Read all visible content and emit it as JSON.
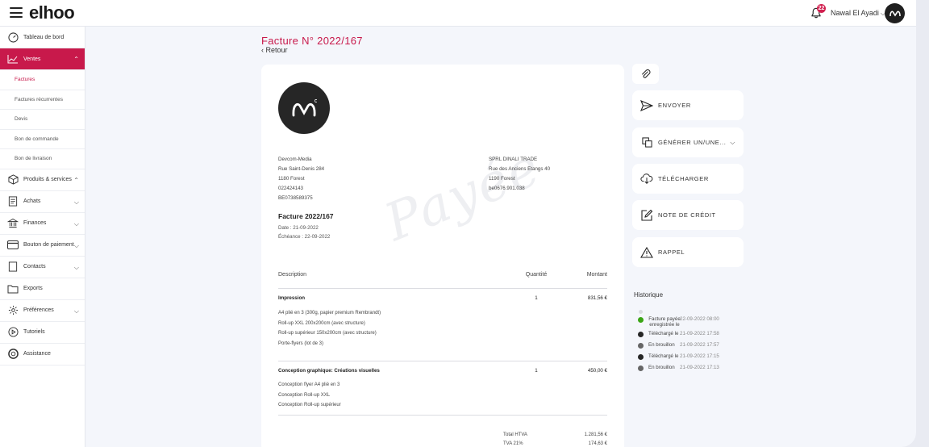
{
  "app": {
    "logo": "elhoo",
    "notifications_count": "22",
    "user_name": "Nawal El Ayadi",
    "avatar_text": "ɯ"
  },
  "sidebar": {
    "items": [
      {
        "label": "Tableau de bord",
        "icon": "gauge-icon"
      },
      {
        "label": "Ventes",
        "icon": "chart-line-icon",
        "active": true
      },
      {
        "label": "Produits & services",
        "icon": "box-icon"
      },
      {
        "label": "Achats",
        "icon": "receipt-icon"
      },
      {
        "label": "Finances",
        "icon": "bank-icon"
      },
      {
        "label": "Bouton de paiement",
        "icon": "card-icon"
      },
      {
        "label": "Contacts",
        "icon": "contact-icon"
      },
      {
        "label": "Exports",
        "icon": "folder-icon"
      },
      {
        "label": "Préférences",
        "icon": "gear-icon"
      },
      {
        "label": "Tutoriels",
        "icon": "play-icon"
      },
      {
        "label": "Assistance",
        "icon": "lifebuoy-icon"
      }
    ],
    "sub_items": [
      "Factures",
      "Factures récurrentes",
      "Devis",
      "Bon de commande",
      "Bon de livraison"
    ]
  },
  "header": {
    "title": "Facture N° 2022/167",
    "back_label": "Retour"
  },
  "invoice": {
    "watermark": "Payée",
    "seller": {
      "name": "Devcom-Media",
      "street": "Rue Saint-Denis 284",
      "city": "1180 Forest",
      "phone": "022424143",
      "vat": "BE0738589375"
    },
    "buyer": {
      "name": "SPRL DINALI TRADE",
      "street": "Rue des Anciens Etangs 40",
      "city": "1190 Forest",
      "vat": "be0676.901.038"
    },
    "title": "Facture 2022/167",
    "date": "Date : 21-09-2022",
    "due": "Échéance : 22-09-2022",
    "columns": {
      "description": "Description",
      "quantity": "Quantité",
      "amount": "Montant"
    },
    "lines": [
      {
        "title": "Impression",
        "quantity": "1",
        "amount": "831,56 €",
        "details": [
          "A4 plié en 3 (300g, papier premium Rembrandt)",
          "Roll-up XXL 200x200cm (avec structure)",
          "Roll-up supérieur 150x200cm (avec structure)",
          "Porte-flyers (lot de 3)"
        ]
      },
      {
        "title": "Conception graphique: Créations visuelles",
        "quantity": "1",
        "amount": "450,00 €",
        "details": [
          "Conception flyer A4 plié en 3",
          "Conception Roll-up XXL",
          "Conception Roll-up supérieur"
        ]
      }
    ],
    "totals": [
      {
        "label": "Total HTVA",
        "value": "1.281,56 €"
      },
      {
        "label": "TVA 21%",
        "value": "174,63 €"
      }
    ]
  },
  "actions": {
    "send": "ENVOYER",
    "generate": "GÉNÉRER UN/UNE...",
    "download": "TÉLÉCHARGER",
    "credit_note": "NOTE DE CRÉDIT",
    "reminder": "RAPPEL"
  },
  "history": {
    "title": "Historique",
    "entries": [
      {
        "label": "Facture payée enregistrée le",
        "datetime": "22-09-2022 08:00",
        "color": "#3aa515"
      },
      {
        "label": "Téléchargé le",
        "datetime": "21-09-2022 17:58",
        "color": "#262626"
      },
      {
        "label": "En brouillon",
        "datetime": "21-09-2022 17:57",
        "color": "#666666"
      },
      {
        "label": "Téléchargé le",
        "datetime": "21-09-2022 17:15",
        "color": "#262626"
      },
      {
        "label": "En brouillon",
        "datetime": "21-09-2022 17:13",
        "color": "#666666"
      }
    ]
  },
  "colors": {
    "accent": "#c8194b"
  }
}
